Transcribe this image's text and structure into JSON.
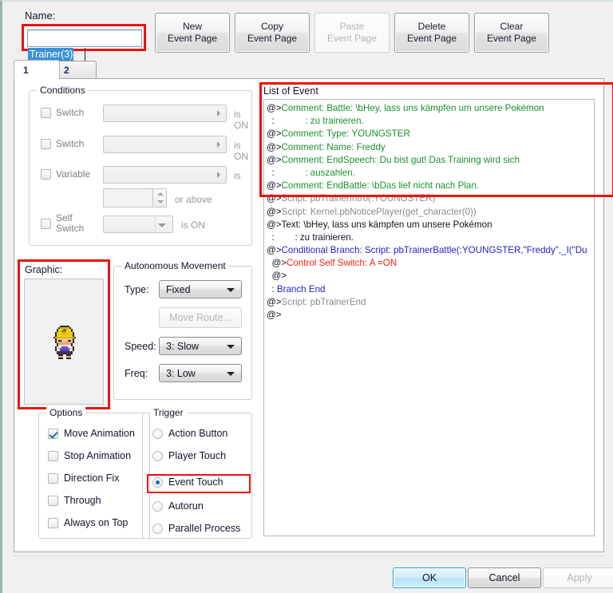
{
  "name_field": {
    "label": "Name:",
    "value": "Trainer(3)",
    "selected": true
  },
  "page_buttons": [
    {
      "line1": "New",
      "line2": "Event Page",
      "disabled": false,
      "name": "new-event-page-button"
    },
    {
      "line1": "Copy",
      "line2": "Event Page",
      "disabled": false,
      "name": "copy-event-page-button"
    },
    {
      "line1": "Paste",
      "line2": "Event Page",
      "disabled": true,
      "name": "paste-event-page-button"
    },
    {
      "line1": "Delete",
      "line2": "Event Page",
      "disabled": false,
      "name": "delete-event-page-button"
    },
    {
      "line1": "Clear",
      "line2": "Event Page",
      "disabled": false,
      "name": "clear-event-page-button"
    }
  ],
  "tabs": [
    {
      "label": "1",
      "active": true
    },
    {
      "label": "2",
      "active": false
    }
  ],
  "conditions": {
    "title": "Conditions",
    "rows": [
      {
        "label": "Switch",
        "checked": false,
        "value": "",
        "suffix": "is ON"
      },
      {
        "label": "Switch",
        "checked": false,
        "value": "",
        "suffix": "is ON"
      },
      {
        "label": "Variable",
        "checked": false,
        "value": "",
        "suffix": "is"
      },
      {
        "label": "",
        "checked": null,
        "value": "",
        "suffix": "or above"
      },
      {
        "label": "Self\nSwitch",
        "checked": false,
        "value": "",
        "suffix": "is ON"
      }
    ],
    "self_switch_label_line1": "Self",
    "self_switch_label_line2": "Switch"
  },
  "graphic": {
    "label": "Graphic:",
    "sprite_name": "youngster-trainer-sprite",
    "highlighted": true
  },
  "autonomous_movement": {
    "title": "Autonomous Movement",
    "type_label": "Type:",
    "type_value": "Fixed",
    "move_route_label": "Move Route...",
    "move_route_disabled": true,
    "speed_label": "Speed:",
    "speed_value": "3: Slow",
    "freq_label": "Freq:",
    "freq_value": "3: Low"
  },
  "options": {
    "title": "Options",
    "items": [
      {
        "label": "Move Animation",
        "checked": true
      },
      {
        "label": "Stop Animation",
        "checked": false
      },
      {
        "label": "Direction Fix",
        "checked": false
      },
      {
        "label": "Through",
        "checked": false
      },
      {
        "label": "Always on Top",
        "checked": false
      }
    ]
  },
  "trigger": {
    "title": "Trigger",
    "items": [
      {
        "label": "Action Button",
        "selected": false
      },
      {
        "label": "Player Touch",
        "selected": false
      },
      {
        "label": "Event Touch",
        "selected": true
      },
      {
        "label": "Autorun",
        "selected": false
      },
      {
        "label": "Parallel Process",
        "selected": false
      }
    ],
    "highlighted_item": "Event Touch"
  },
  "list_of_event": {
    "label": "List of Event",
    "highlight_through_line": 7,
    "lines": [
      {
        "prefix": "@>",
        "text": "Comment: Battle: \\bHey, lass uns kämpfen um unsere Pokémon",
        "color": "green",
        "indent": 0
      },
      {
        "prefix": "  :",
        "text": "            : zu trainieren.",
        "color": "green",
        "indent": 0
      },
      {
        "prefix": "@>",
        "text": "Comment: Type: YOUNGSTER",
        "color": "green",
        "indent": 0
      },
      {
        "prefix": "@>",
        "text": "Comment: Name: Freddy",
        "color": "green",
        "indent": 0
      },
      {
        "prefix": "@>",
        "text": "Comment: EndSpeech: Du bist gut! Das Training wird sich",
        "color": "green",
        "indent": 0
      },
      {
        "prefix": "  :",
        "text": "            : auszahlen.",
        "color": "green",
        "indent": 0
      },
      {
        "prefix": "@>",
        "text": "Comment: EndBattle: \\bDas lief nicht nach Plan.",
        "color": "green",
        "indent": 0
      },
      {
        "prefix": "@>",
        "text": "Script: pbTrainerIntro(:YOUNGSTER)",
        "color": "gray",
        "indent": 0
      },
      {
        "prefix": "@>",
        "text": "Script: Kernel.pbNoticePlayer(get_character(0))",
        "color": "gray",
        "indent": 0
      },
      {
        "prefix": "@>",
        "text": "Text: \\bHey, lass uns kämpfen um unsere Pokémon",
        "color": "black",
        "indent": 0
      },
      {
        "prefix": "  :",
        "text": "        : zu trainieren.",
        "color": "black",
        "indent": 0
      },
      {
        "prefix": "@>",
        "text": "Conditional Branch: Script: pbTrainerBattle(:YOUNGSTER,\"Freddy\",_I(\"Du",
        "color": "blue",
        "indent": 0
      },
      {
        "prefix": "  @>",
        "text": "Control Self Switch: A =ON",
        "color": "red",
        "indent": 1
      },
      {
        "prefix": "  @>",
        "text": "",
        "color": "black",
        "indent": 1
      },
      {
        "prefix": "  :",
        "text": " Branch End",
        "color": "blue",
        "indent": 1
      },
      {
        "prefix": "@>",
        "text": "Script: pbTrainerEnd",
        "color": "gray",
        "indent": 0
      },
      {
        "prefix": "@>",
        "text": "",
        "color": "black",
        "indent": 0
      }
    ]
  },
  "dialog_buttons": [
    {
      "label": "OK",
      "state": "focus",
      "name": "ok-button"
    },
    {
      "label": "Cancel",
      "state": "normal",
      "name": "cancel-button"
    },
    {
      "label": "Apply",
      "state": "disabled",
      "name": "apply-button"
    }
  ],
  "colors": {
    "highlight_red": "#ee1111",
    "comment_green": "#1a8f2e",
    "script_gray": "#8b8b8b",
    "branch_blue": "#2222cc",
    "selfswitch_red": "#ee2211",
    "selection_blue": "#3a8fd8",
    "panel_bg": "#ffffff",
    "window_bg": "#f0f0f0"
  }
}
